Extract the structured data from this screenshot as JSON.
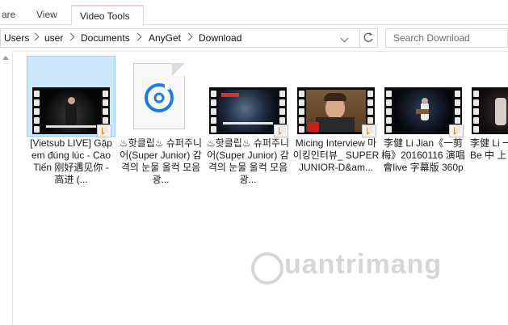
{
  "ribbon": {
    "tabs": [
      "are",
      "View",
      "Video Tools"
    ]
  },
  "address": {
    "crumbs": [
      "Users",
      "user",
      "Documents",
      "AnyGet",
      "Download"
    ],
    "search_placeholder": "Search Download"
  },
  "files": [
    {
      "name": "[Vietsub LIVE] Gặp em đúng lúc - Cao Tiến 刚好遇见你 - 高进 (...",
      "type": "video",
      "selected": true
    },
    {
      "name": "♨핫클립♨ 슈퍼주니어(Super Junior) 감격의 눈물 울컥 모음 광...",
      "type": "audio"
    },
    {
      "name": "♨핫클립♨ 슈퍼주니어(Super Junior) 감격의 눈물 울컥 모음 광...",
      "type": "video"
    },
    {
      "name": "Micing Interview 마이킹인터뷰_ SUPER JUNIOR-D&am...",
      "type": "video"
    },
    {
      "name": "李健 Li Jian《一剪梅》20160116 演唱會live 字幕版 360p",
      "type": "video"
    },
    {
      "name": "李健 Li 一生所爱 It Be 中 上，是李",
      "type": "video"
    }
  ],
  "watermark": "uantrimang",
  "colors": {
    "accent_play": "#f08b1b",
    "selection": "#cce8ff",
    "audio_icon": "#1e7dd8"
  }
}
